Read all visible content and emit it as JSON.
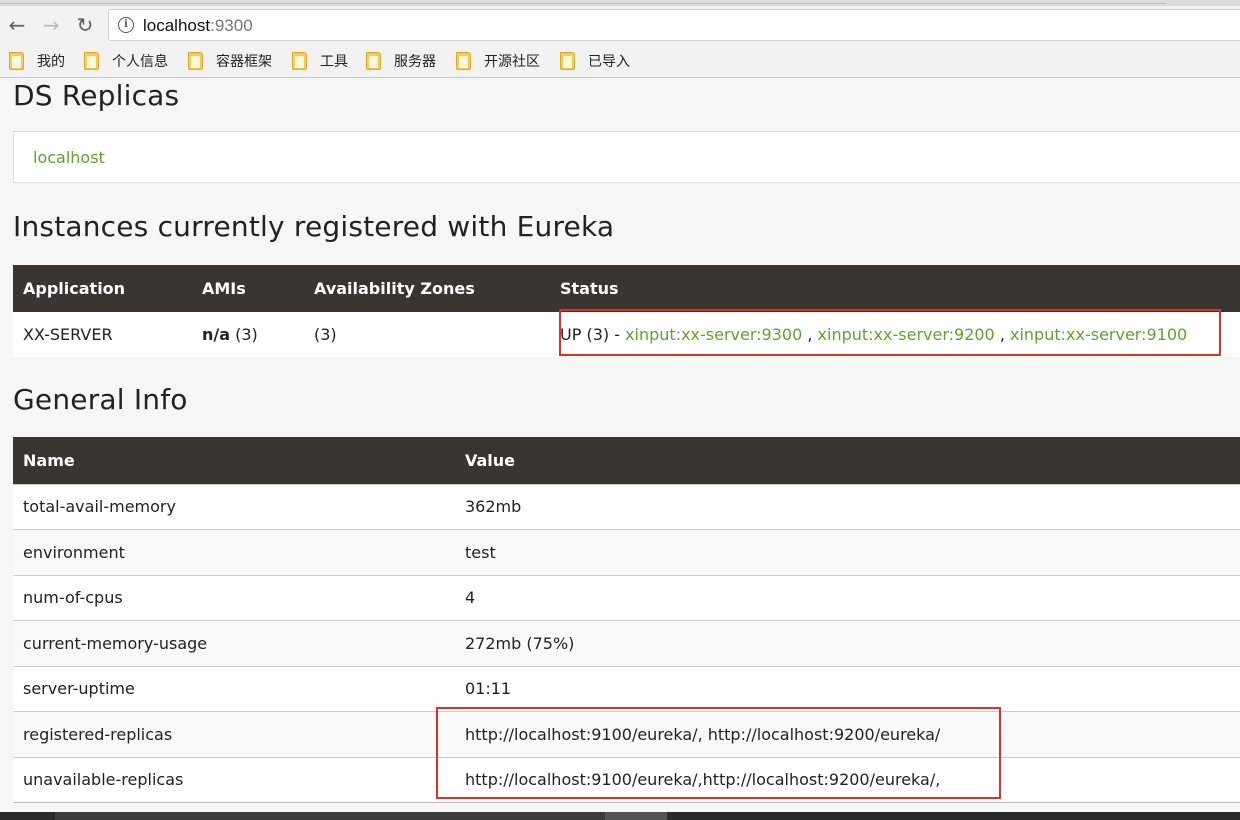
{
  "browser": {
    "url_host": "localhost",
    "url_port": ":9300",
    "bookmarks": [
      "我的",
      "个人信息",
      "容器框架",
      "工具",
      "服务器",
      "开源社区",
      "已导入"
    ]
  },
  "ds_replicas": {
    "title": "DS Replicas",
    "link": "localhost"
  },
  "instances": {
    "title": "Instances currently registered with Eureka",
    "columns": [
      "Application",
      "AMIs",
      "Availability Zones",
      "Status"
    ],
    "rows": [
      {
        "application": "XX-SERVER",
        "amis_bold": "n/a",
        "amis_count": " (3)",
        "zones": "(3)",
        "status_prefix": "UP (3) - ",
        "status_links": [
          "xinput:xx-server:9300",
          "xinput:xx-server:9200",
          "xinput:xx-server:9100"
        ],
        "separator": " , "
      }
    ]
  },
  "general_info": {
    "title": "General Info",
    "columns": [
      "Name",
      "Value"
    ],
    "rows": [
      {
        "name": "total-avail-memory",
        "value": "362mb"
      },
      {
        "name": "environment",
        "value": "test"
      },
      {
        "name": "num-of-cpus",
        "value": "4"
      },
      {
        "name": "current-memory-usage",
        "value": "272mb (75%)"
      },
      {
        "name": "server-uptime",
        "value": "01:11"
      },
      {
        "name": "registered-replicas",
        "value": "http://localhost:9100/eureka/, http://localhost:9200/eureka/"
      },
      {
        "name": "unavailable-replicas",
        "value": "http://localhost:9100/eureka/,http://localhost:9200/eureka/,"
      }
    ]
  },
  "colors": {
    "link_green": "#5fa134",
    "header_dark": "#393632",
    "highlight_red": "#d9342b"
  }
}
